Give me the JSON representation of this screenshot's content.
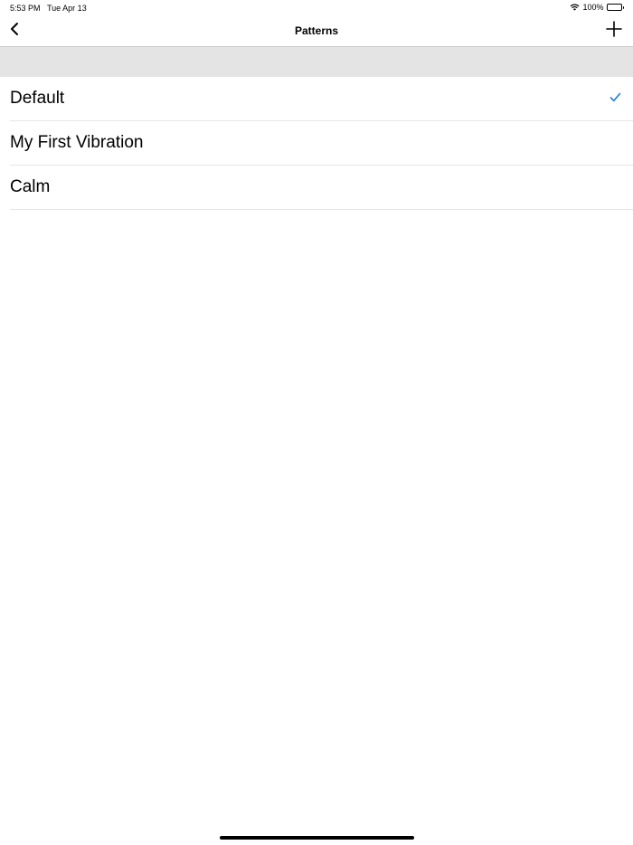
{
  "status_bar": {
    "time": "5:53 PM",
    "date": "Tue Apr 13",
    "battery": "100%"
  },
  "nav": {
    "title": "Patterns",
    "back_icon": "chevron-left-icon",
    "add_icon": "plus-icon"
  },
  "patterns": {
    "items": [
      {
        "label": "Default",
        "selected": true
      },
      {
        "label": "My First Vibration",
        "selected": false
      },
      {
        "label": "Calm",
        "selected": false
      }
    ]
  },
  "colors": {
    "accent": "#1a7fd6",
    "section_bg": "#e4e4e4",
    "separator": "#e6e6e6"
  }
}
